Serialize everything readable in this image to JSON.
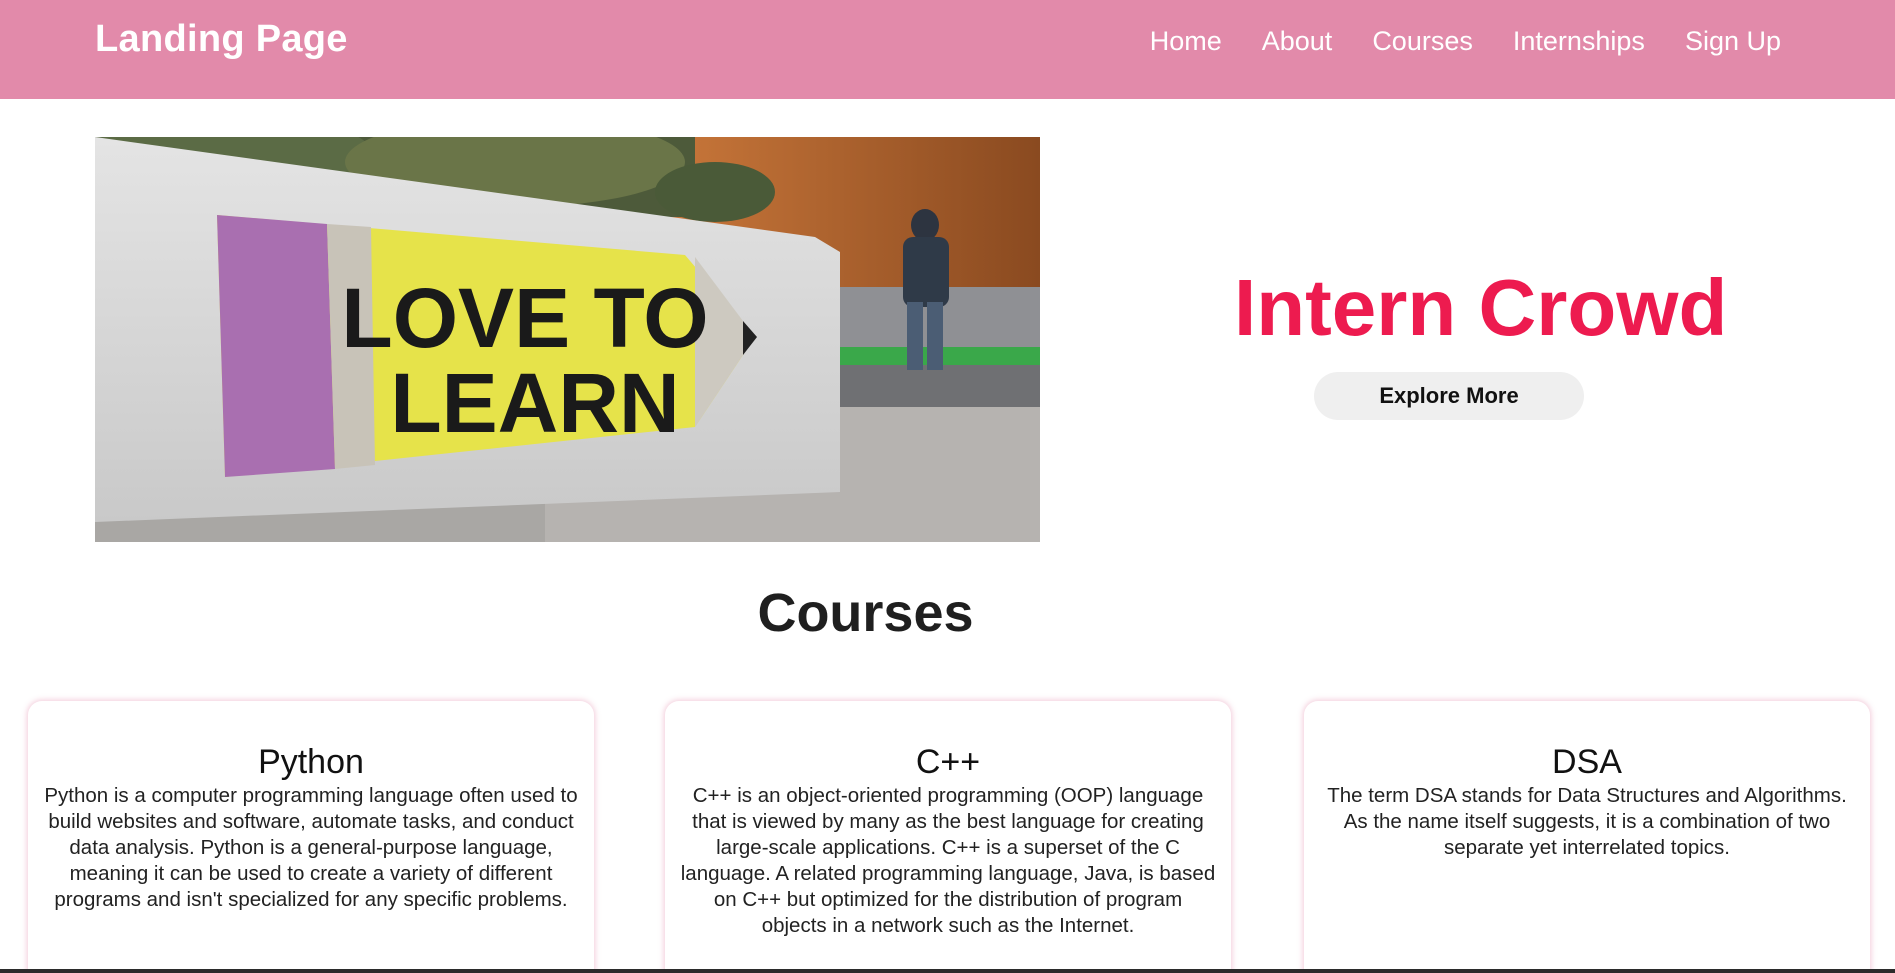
{
  "header": {
    "brand": "Landing Page",
    "nav": [
      "Home",
      "About",
      "Courses",
      "Internships",
      "Sign Up"
    ],
    "background": "#e28aaa"
  },
  "hero": {
    "image_sign_text_line1": "LOVE TO",
    "image_sign_text_line2": "LEARN",
    "title": "Intern Crowd",
    "title_color": "#ed1b4f",
    "button_label": "Explore More"
  },
  "courses": {
    "heading": "Courses",
    "cards": [
      {
        "title": "Python",
        "text": "Python is a computer programming language often used to build websites and software, automate tasks, and conduct data analysis. Python is a general-purpose language, meaning it can be used to create a variety of different programs and isn't specialized for any specific problems."
      },
      {
        "title": "C++",
        "text": "C++ is an object-oriented programming (OOP) language that is viewed by many as the best language for creating large-scale applications. C++ is a superset of the C language. A related programming language, Java, is based on C++ but optimized for the distribution of program objects in a network such as the Internet."
      },
      {
        "title": "DSA",
        "text": "The term DSA stands for Data Structures and Algorithms. As the name itself suggests, it is a combination of two separate yet interrelated topics."
      }
    ]
  }
}
